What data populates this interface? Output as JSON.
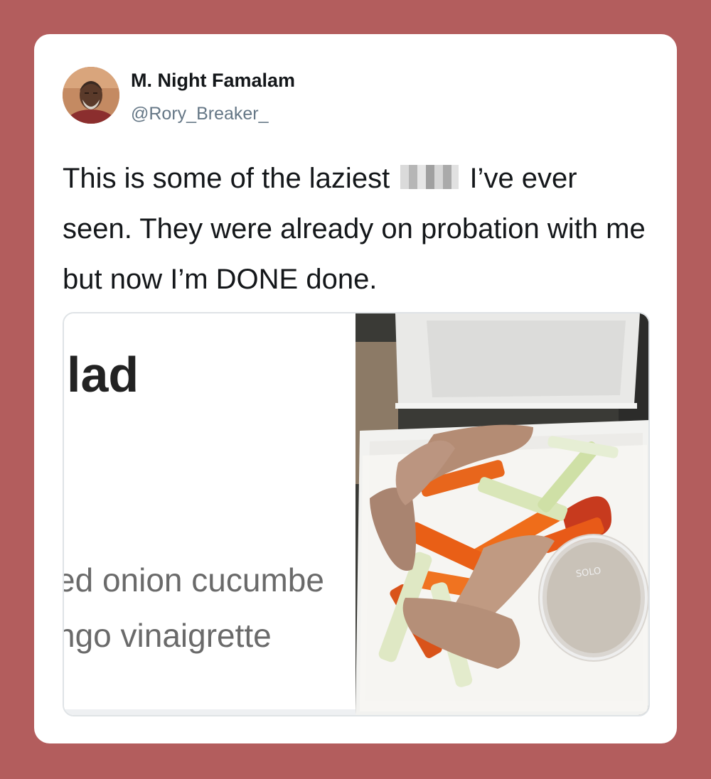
{
  "user": {
    "display_name": "M. Night Famalam",
    "handle": "@Rory_Breaker_"
  },
  "tweet": {
    "text_before": "This is some of the laziest",
    "text_after": "I’ve ever seen. They were already on probation with me but now I’m DONE done."
  },
  "media": {
    "menu_screenshot": {
      "title": "lad",
      "line1": "ed onion cucumbe",
      "line2": "ngo vinaigrette"
    },
    "photo_cup_label": "SOLO"
  },
  "colors": {
    "background": "#b35d5d",
    "card": "#ffffff",
    "text": "#14171a",
    "handle": "#657786"
  }
}
